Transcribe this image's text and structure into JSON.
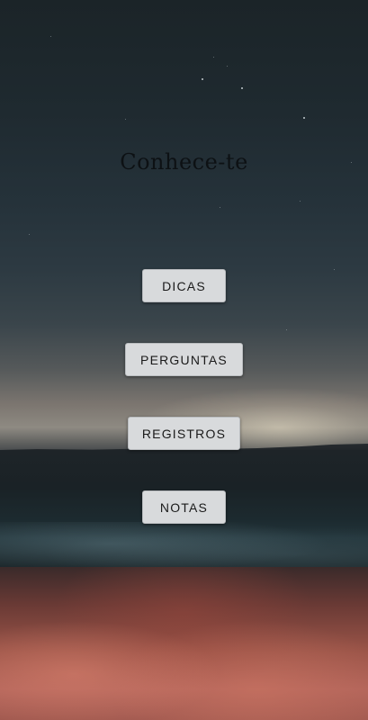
{
  "app": {
    "title": "Conhece-te"
  },
  "menu": {
    "buttons": [
      {
        "id": "dicas",
        "label": "DICAS"
      },
      {
        "id": "perguntas",
        "label": "PERGUNTAS"
      },
      {
        "id": "registros",
        "label": "REGISTROS"
      },
      {
        "id": "notas",
        "label": "NOTAS"
      }
    ]
  },
  "colors": {
    "button_bg": "#d8dadc",
    "title_text": "#0d1114",
    "sky_top": "#1b2428",
    "sand": "#b1645a"
  },
  "background": {
    "image": "night-beach-photo"
  }
}
